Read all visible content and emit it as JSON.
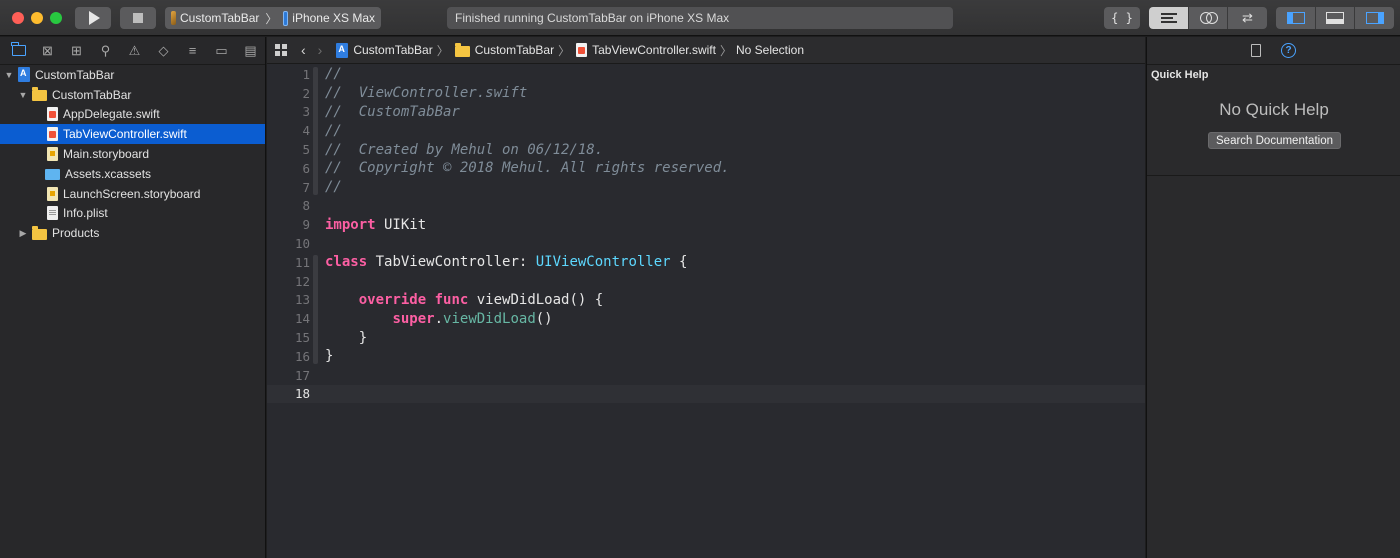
{
  "toolbar": {
    "scheme_name": "CustomTabBar",
    "device_name": "iPhone XS Max",
    "status_text": "Finished running CustomTabBar on iPhone XS Max",
    "library_label": "{ }"
  },
  "navigator": {
    "tabs": [
      "folder-icon",
      "source-control-icon",
      "symbol-icon",
      "search-icon",
      "issue-icon",
      "test-icon",
      "debug-icon",
      "breakpoint-icon",
      "report-icon"
    ],
    "tree": [
      {
        "label": "CustomTabBar",
        "kind": "project",
        "depth": 0,
        "expanded": true
      },
      {
        "label": "CustomTabBar",
        "kind": "folder",
        "depth": 1,
        "expanded": true
      },
      {
        "label": "AppDelegate.swift",
        "kind": "swift",
        "depth": 2
      },
      {
        "label": "TabViewController.swift",
        "kind": "swift",
        "depth": 2,
        "selected": true
      },
      {
        "label": "Main.storyboard",
        "kind": "storyboard",
        "depth": 2
      },
      {
        "label": "Assets.xcassets",
        "kind": "assets",
        "depth": 2
      },
      {
        "label": "LaunchScreen.storyboard",
        "kind": "storyboard",
        "depth": 2
      },
      {
        "label": "Info.plist",
        "kind": "plist",
        "depth": 2
      },
      {
        "label": "Products",
        "kind": "folder",
        "depth": 1,
        "expanded": false
      }
    ]
  },
  "jumpbar": {
    "project": "CustomTabBar",
    "group": "CustomTabBar",
    "file": "TabViewController.swift",
    "selection": "No Selection"
  },
  "editor": {
    "current_line": 18,
    "lines": [
      [
        {
          "t": "//",
          "c": "comment"
        }
      ],
      [
        {
          "t": "//  ViewController.swift",
          "c": "comment"
        }
      ],
      [
        {
          "t": "//  CustomTabBar",
          "c": "comment"
        }
      ],
      [
        {
          "t": "//",
          "c": "comment"
        }
      ],
      [
        {
          "t": "//  Created by Mehul on 06/12/18.",
          "c": "comment"
        }
      ],
      [
        {
          "t": "//  Copyright © 2018 Mehul. All rights reserved.",
          "c": "comment"
        }
      ],
      [
        {
          "t": "//",
          "c": "comment"
        }
      ],
      [],
      [
        {
          "t": "import",
          "c": "kw"
        },
        {
          "t": " UIKit",
          "c": "plain"
        }
      ],
      [],
      [
        {
          "t": "class",
          "c": "kw"
        },
        {
          "t": " TabViewController: ",
          "c": "plain"
        },
        {
          "t": "UIViewController",
          "c": "type"
        },
        {
          "t": " {",
          "c": "plain"
        }
      ],
      [],
      [
        {
          "t": "    ",
          "c": "plain"
        },
        {
          "t": "override",
          "c": "kw"
        },
        {
          "t": " ",
          "c": "plain"
        },
        {
          "t": "func",
          "c": "kw"
        },
        {
          "t": " viewDidLoad() {",
          "c": "plain"
        }
      ],
      [
        {
          "t": "        ",
          "c": "plain"
        },
        {
          "t": "super",
          "c": "kw"
        },
        {
          "t": ".",
          "c": "plain"
        },
        {
          "t": "viewDidLoad",
          "c": "call"
        },
        {
          "t": "()",
          "c": "plain"
        }
      ],
      [
        {
          "t": "    }",
          "c": "plain"
        }
      ],
      [
        {
          "t": "}",
          "c": "plain"
        }
      ],
      [],
      []
    ]
  },
  "inspector": {
    "title": "Quick Help",
    "empty_text": "No Quick Help",
    "search_button": "Search Documentation"
  }
}
